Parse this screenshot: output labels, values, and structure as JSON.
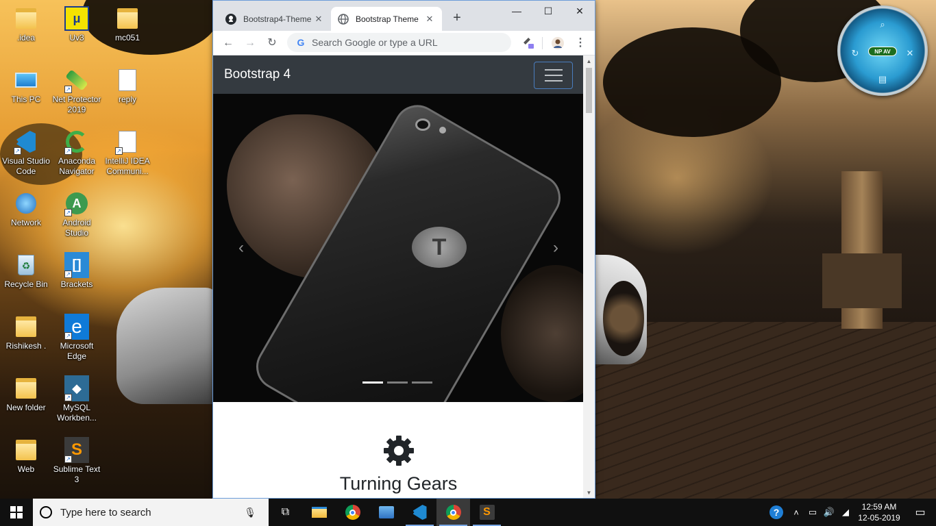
{
  "desktop": {
    "icons": [
      {
        "label": ".idea"
      },
      {
        "label": "Uv3"
      },
      {
        "label": "mc051"
      },
      {
        "label": "This PC"
      },
      {
        "label": "Net Protector\n2019"
      },
      {
        "label": "reply"
      },
      {
        "label": "Visual Studio\nCode"
      },
      {
        "label": "Anaconda\nNavigator"
      },
      {
        "label": "IntelliJ IDEA\nCommuni..."
      },
      {
        "label": "Network"
      },
      {
        "label": "Android\nStudio"
      },
      {
        "label": "Recycle Bin"
      },
      {
        "label": "Brackets"
      },
      {
        "label": "Rishikesh ."
      },
      {
        "label": "Microsoft\nEdge"
      },
      {
        "label": "New folder"
      },
      {
        "label": "MySQL\nWorkben..."
      },
      {
        "label": "Web"
      },
      {
        "label": "Sublime Text\n3"
      }
    ],
    "gadget": {
      "badge": "NP AV"
    }
  },
  "browser": {
    "tabs": [
      {
        "title": "Bootstrap4-Theme",
        "icon": "github-icon"
      },
      {
        "title": "Bootstrap Theme",
        "icon": "globe-icon"
      }
    ],
    "new_tab": "+",
    "window_controls": {
      "minimize": "—",
      "maximize": "☐",
      "close": "✕"
    },
    "omnibox_placeholder": "Search Google or type a URL",
    "page": {
      "brand": "Bootstrap 4",
      "carousel": {
        "slide_count": 3,
        "active_index": 0,
        "logo_letter": "T"
      },
      "feature": {
        "heading": "Turning Gears",
        "icon": "gear-icon"
      }
    }
  },
  "taskbar": {
    "search_placeholder": "Type here to search",
    "apps": [
      "task-view",
      "file-explorer",
      "chrome",
      "windows-explorer-app",
      "vscode",
      "chrome-active",
      "sublime-text"
    ],
    "clock": {
      "time": "12:59 AM",
      "date": "12-05-2019"
    },
    "accent": "#7aa8e6"
  }
}
